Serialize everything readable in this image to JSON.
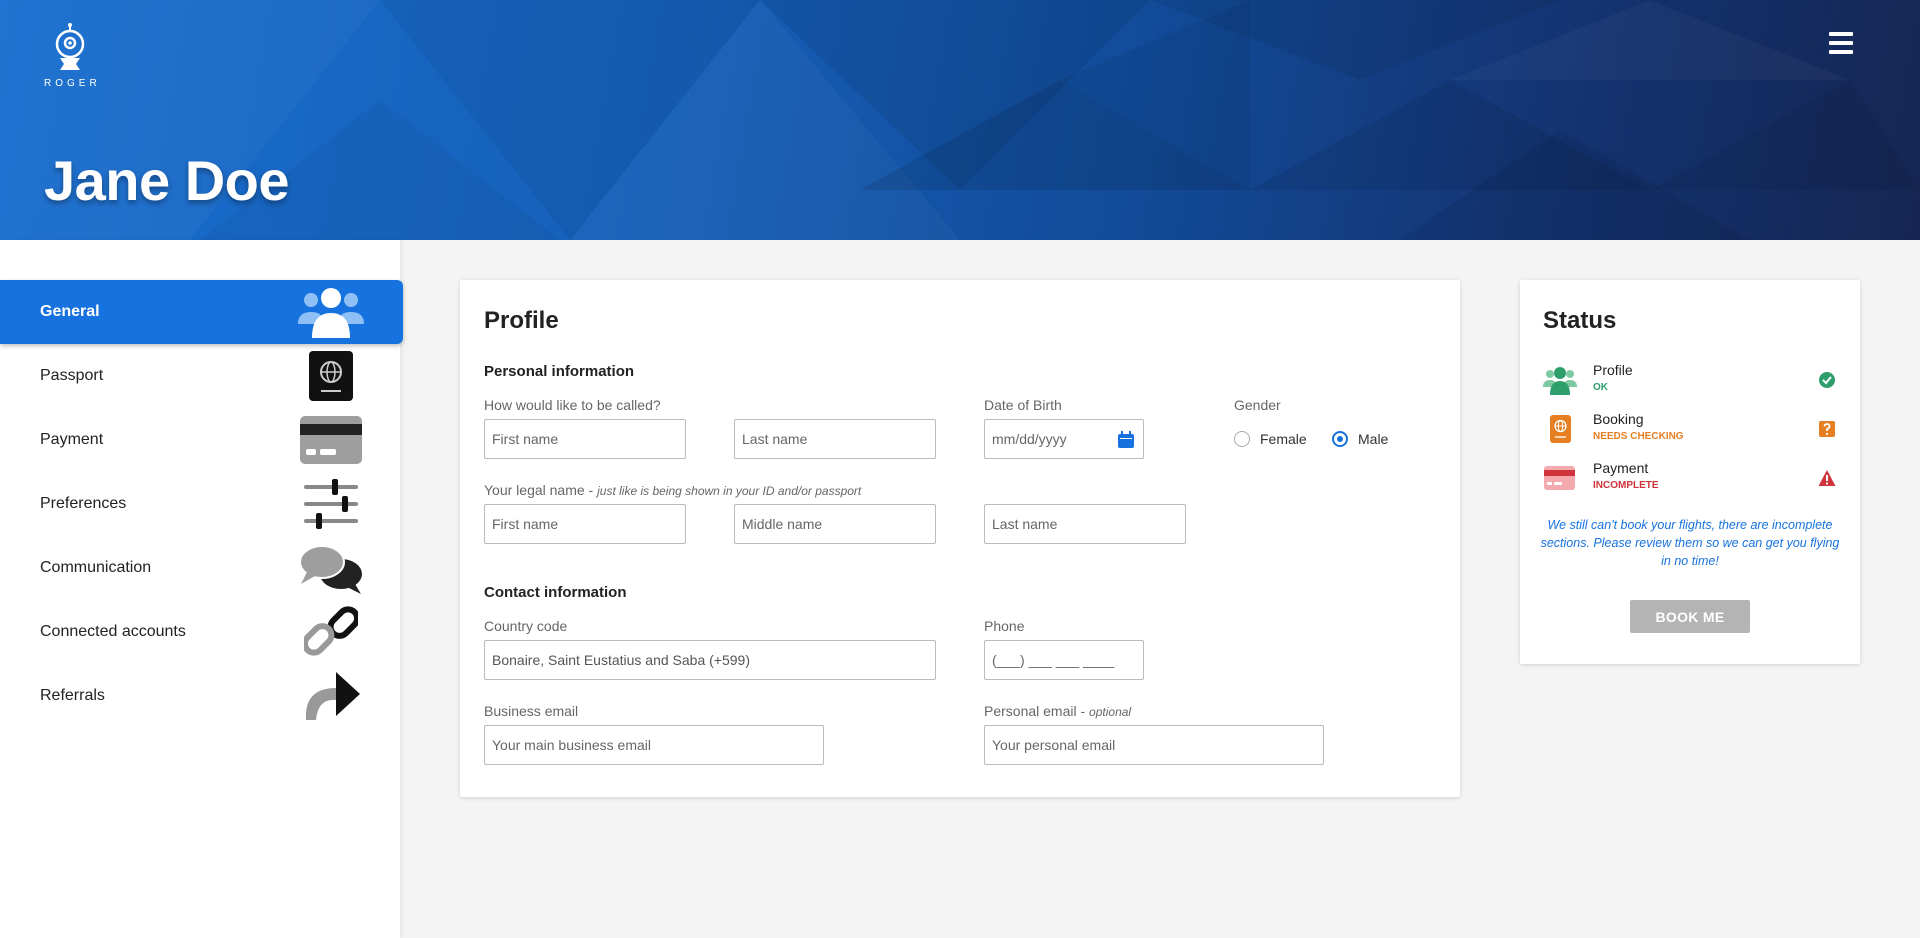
{
  "header": {
    "logo_text": "ROGER",
    "page_title": "Jane Doe",
    "menu_icon": "hamburger-menu-icon"
  },
  "sidebar": {
    "items": [
      {
        "label": "General",
        "icon": "users-icon",
        "active": true
      },
      {
        "label": "Passport",
        "icon": "passport-icon"
      },
      {
        "label": "Payment",
        "icon": "credit-card-icon"
      },
      {
        "label": "Preferences",
        "icon": "sliders-icon"
      },
      {
        "label": "Communication",
        "icon": "chat-bubbles-icon"
      },
      {
        "label": "Connected accounts",
        "icon": "link-icon"
      },
      {
        "label": "Referrals",
        "icon": "share-arrow-icon"
      }
    ]
  },
  "profile": {
    "title": "Profile",
    "personal_section": "Personal information",
    "called_label": "How would like to be called?",
    "called_first_placeholder": "First name",
    "called_last_placeholder": "Last name",
    "dob_label": "Date of Birth",
    "dob_placeholder": "mm/dd/yyyy",
    "gender_label": "Gender",
    "gender_options": [
      "Female",
      "Male"
    ],
    "gender_selected": "Male",
    "legal_label": "Your legal name - ",
    "legal_hint": "just like is being shown in your ID and/or passport",
    "legal_first_placeholder": "First name",
    "legal_middle_placeholder": "Middle name",
    "legal_last_placeholder": "Last name",
    "contact_section": "Contact information",
    "country_label": "Country code",
    "country_value": "Bonaire, Saint Eustatius and Saba (+599)",
    "phone_label": "Phone",
    "phone_placeholder": "(___) ___ ___ ____",
    "business_email_label": "Business email",
    "business_email_placeholder": "Your main business email",
    "personal_email_label": "Personal email - ",
    "personal_email_hint": "optional",
    "personal_email_placeholder": "Your personal email"
  },
  "status": {
    "title": "Status",
    "rows": [
      {
        "name": "Profile",
        "state": "OK",
        "color": "#2e9e6b",
        "indicator": "check-circle-icon"
      },
      {
        "name": "Booking",
        "state": "NEEDS CHECKING",
        "color": "#e67e22",
        "indicator": "question-square-icon"
      },
      {
        "name": "Payment",
        "state": "INCOMPLETE",
        "color": "#d0333b",
        "indicator": "warning-triangle-icon"
      }
    ],
    "note": "We still can't book your flights, there are incomplete sections. Please review them so we can get you flying in no time!",
    "button_label": "BOOK ME"
  },
  "colors": {
    "accent": "#1672de",
    "ok": "#2e9e6b",
    "warning": "#e67e22",
    "error": "#d0333b",
    "button_disabled": "#b4b4b4"
  }
}
